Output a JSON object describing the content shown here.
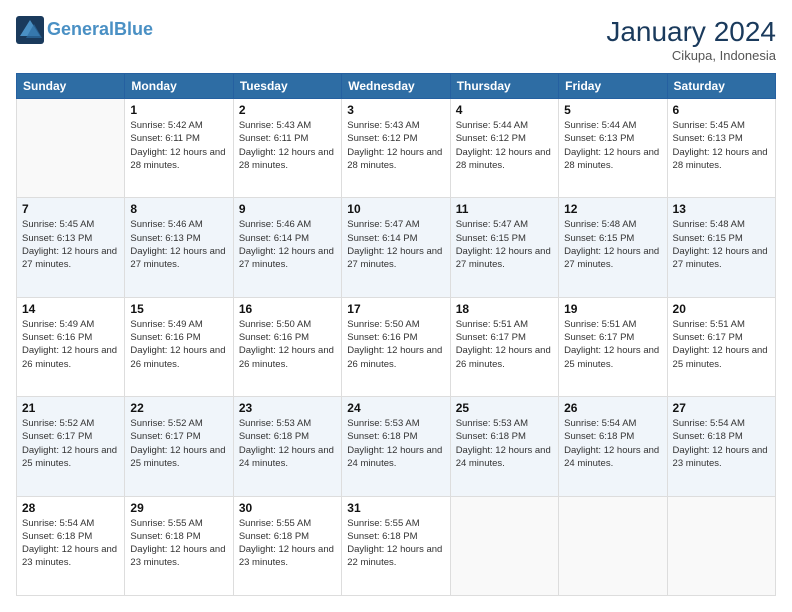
{
  "header": {
    "logo_line1": "General",
    "logo_line2": "Blue",
    "month_title": "January 2024",
    "location": "Cikupa, Indonesia"
  },
  "weekdays": [
    "Sunday",
    "Monday",
    "Tuesday",
    "Wednesday",
    "Thursday",
    "Friday",
    "Saturday"
  ],
  "weeks": [
    [
      {
        "day": "",
        "sunrise": "",
        "sunset": "",
        "daylight": ""
      },
      {
        "day": "1",
        "sunrise": "Sunrise: 5:42 AM",
        "sunset": "Sunset: 6:11 PM",
        "daylight": "Daylight: 12 hours and 28 minutes."
      },
      {
        "day": "2",
        "sunrise": "Sunrise: 5:43 AM",
        "sunset": "Sunset: 6:11 PM",
        "daylight": "Daylight: 12 hours and 28 minutes."
      },
      {
        "day": "3",
        "sunrise": "Sunrise: 5:43 AM",
        "sunset": "Sunset: 6:12 PM",
        "daylight": "Daylight: 12 hours and 28 minutes."
      },
      {
        "day": "4",
        "sunrise": "Sunrise: 5:44 AM",
        "sunset": "Sunset: 6:12 PM",
        "daylight": "Daylight: 12 hours and 28 minutes."
      },
      {
        "day": "5",
        "sunrise": "Sunrise: 5:44 AM",
        "sunset": "Sunset: 6:13 PM",
        "daylight": "Daylight: 12 hours and 28 minutes."
      },
      {
        "day": "6",
        "sunrise": "Sunrise: 5:45 AM",
        "sunset": "Sunset: 6:13 PM",
        "daylight": "Daylight: 12 hours and 28 minutes."
      }
    ],
    [
      {
        "day": "7",
        "sunrise": "Sunrise: 5:45 AM",
        "sunset": "Sunset: 6:13 PM",
        "daylight": "Daylight: 12 hours and 27 minutes."
      },
      {
        "day": "8",
        "sunrise": "Sunrise: 5:46 AM",
        "sunset": "Sunset: 6:13 PM",
        "daylight": "Daylight: 12 hours and 27 minutes."
      },
      {
        "day": "9",
        "sunrise": "Sunrise: 5:46 AM",
        "sunset": "Sunset: 6:14 PM",
        "daylight": "Daylight: 12 hours and 27 minutes."
      },
      {
        "day": "10",
        "sunrise": "Sunrise: 5:47 AM",
        "sunset": "Sunset: 6:14 PM",
        "daylight": "Daylight: 12 hours and 27 minutes."
      },
      {
        "day": "11",
        "sunrise": "Sunrise: 5:47 AM",
        "sunset": "Sunset: 6:15 PM",
        "daylight": "Daylight: 12 hours and 27 minutes."
      },
      {
        "day": "12",
        "sunrise": "Sunrise: 5:48 AM",
        "sunset": "Sunset: 6:15 PM",
        "daylight": "Daylight: 12 hours and 27 minutes."
      },
      {
        "day": "13",
        "sunrise": "Sunrise: 5:48 AM",
        "sunset": "Sunset: 6:15 PM",
        "daylight": "Daylight: 12 hours and 27 minutes."
      }
    ],
    [
      {
        "day": "14",
        "sunrise": "Sunrise: 5:49 AM",
        "sunset": "Sunset: 6:16 PM",
        "daylight": "Daylight: 12 hours and 26 minutes."
      },
      {
        "day": "15",
        "sunrise": "Sunrise: 5:49 AM",
        "sunset": "Sunset: 6:16 PM",
        "daylight": "Daylight: 12 hours and 26 minutes."
      },
      {
        "day": "16",
        "sunrise": "Sunrise: 5:50 AM",
        "sunset": "Sunset: 6:16 PM",
        "daylight": "Daylight: 12 hours and 26 minutes."
      },
      {
        "day": "17",
        "sunrise": "Sunrise: 5:50 AM",
        "sunset": "Sunset: 6:16 PM",
        "daylight": "Daylight: 12 hours and 26 minutes."
      },
      {
        "day": "18",
        "sunrise": "Sunrise: 5:51 AM",
        "sunset": "Sunset: 6:17 PM",
        "daylight": "Daylight: 12 hours and 26 minutes."
      },
      {
        "day": "19",
        "sunrise": "Sunrise: 5:51 AM",
        "sunset": "Sunset: 6:17 PM",
        "daylight": "Daylight: 12 hours and 25 minutes."
      },
      {
        "day": "20",
        "sunrise": "Sunrise: 5:51 AM",
        "sunset": "Sunset: 6:17 PM",
        "daylight": "Daylight: 12 hours and 25 minutes."
      }
    ],
    [
      {
        "day": "21",
        "sunrise": "Sunrise: 5:52 AM",
        "sunset": "Sunset: 6:17 PM",
        "daylight": "Daylight: 12 hours and 25 minutes."
      },
      {
        "day": "22",
        "sunrise": "Sunrise: 5:52 AM",
        "sunset": "Sunset: 6:17 PM",
        "daylight": "Daylight: 12 hours and 25 minutes."
      },
      {
        "day": "23",
        "sunrise": "Sunrise: 5:53 AM",
        "sunset": "Sunset: 6:18 PM",
        "daylight": "Daylight: 12 hours and 24 minutes."
      },
      {
        "day": "24",
        "sunrise": "Sunrise: 5:53 AM",
        "sunset": "Sunset: 6:18 PM",
        "daylight": "Daylight: 12 hours and 24 minutes."
      },
      {
        "day": "25",
        "sunrise": "Sunrise: 5:53 AM",
        "sunset": "Sunset: 6:18 PM",
        "daylight": "Daylight: 12 hours and 24 minutes."
      },
      {
        "day": "26",
        "sunrise": "Sunrise: 5:54 AM",
        "sunset": "Sunset: 6:18 PM",
        "daylight": "Daylight: 12 hours and 24 minutes."
      },
      {
        "day": "27",
        "sunrise": "Sunrise: 5:54 AM",
        "sunset": "Sunset: 6:18 PM",
        "daylight": "Daylight: 12 hours and 23 minutes."
      }
    ],
    [
      {
        "day": "28",
        "sunrise": "Sunrise: 5:54 AM",
        "sunset": "Sunset: 6:18 PM",
        "daylight": "Daylight: 12 hours and 23 minutes."
      },
      {
        "day": "29",
        "sunrise": "Sunrise: 5:55 AM",
        "sunset": "Sunset: 6:18 PM",
        "daylight": "Daylight: 12 hours and 23 minutes."
      },
      {
        "day": "30",
        "sunrise": "Sunrise: 5:55 AM",
        "sunset": "Sunset: 6:18 PM",
        "daylight": "Daylight: 12 hours and 23 minutes."
      },
      {
        "day": "31",
        "sunrise": "Sunrise: 5:55 AM",
        "sunset": "Sunset: 6:18 PM",
        "daylight": "Daylight: 12 hours and 22 minutes."
      },
      {
        "day": "",
        "sunrise": "",
        "sunset": "",
        "daylight": ""
      },
      {
        "day": "",
        "sunrise": "",
        "sunset": "",
        "daylight": ""
      },
      {
        "day": "",
        "sunrise": "",
        "sunset": "",
        "daylight": ""
      }
    ]
  ]
}
